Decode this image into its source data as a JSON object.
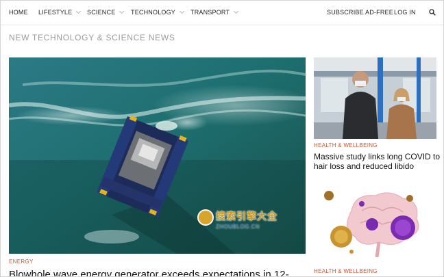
{
  "nav": {
    "items": [
      {
        "label": "HOME",
        "has_menu": false
      },
      {
        "label": "LIFESTYLE",
        "has_menu": true
      },
      {
        "label": "SCIENCE",
        "has_menu": true
      },
      {
        "label": "TECHNOLOGY",
        "has_menu": true
      },
      {
        "label": "TRANSPORT",
        "has_menu": true
      }
    ],
    "subscribe_label": "SUBSCRIBE AD-FREE",
    "login_label": "LOG IN",
    "search_icon": "search-icon"
  },
  "section_title": "NEW TECHNOLOGY & SCIENCE NEWS",
  "hero": {
    "category": "ENERGY",
    "headline": "Blowhole wave energy generator exceeds expectations in 12-"
  },
  "watermark": {
    "text": "搜索引擎大全",
    "sub": "ZHOUBLOG.CN"
  },
  "cards": [
    {
      "category": "HEALTH & WELLBEING",
      "title": "Massive study links long COVID to hair loss and reduced libido"
    },
    {
      "category": "HEALTH & WELLBEING",
      "title": ""
    }
  ],
  "colors": {
    "category": "#d6542c",
    "section_title": "#9a9a9a",
    "text": "#222222"
  }
}
